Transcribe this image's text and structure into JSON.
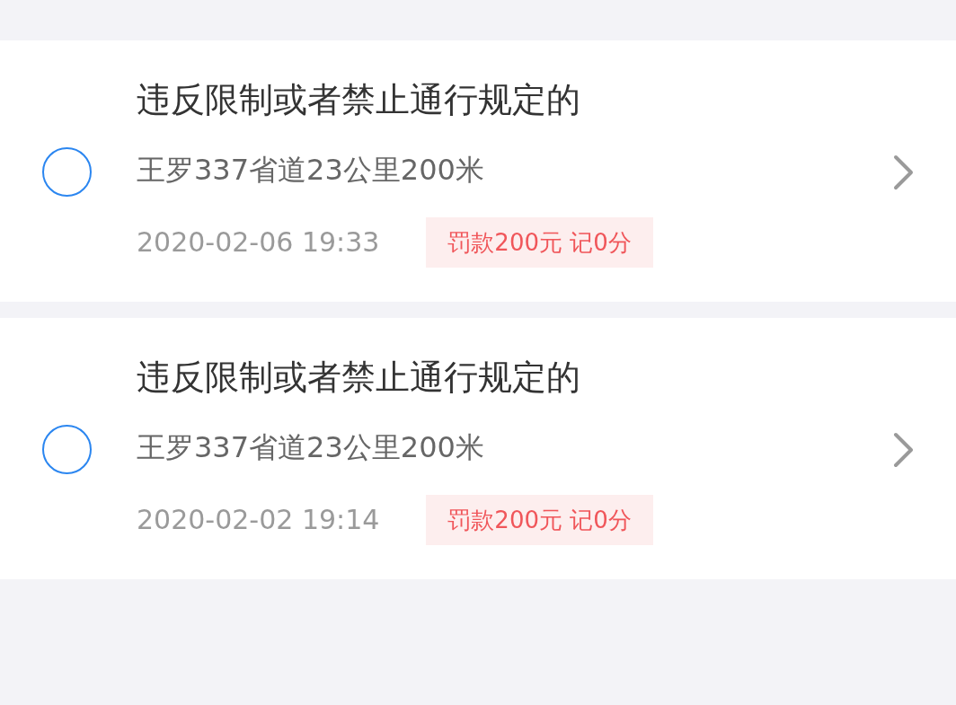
{
  "violations": [
    {
      "title": "违反限制或者禁止通行规定的",
      "location": "王罗337省道23公里200米",
      "time": "2020-02-06 19:33",
      "penalty": "罚款200元 记0分",
      "selected": false
    },
    {
      "title": "违反限制或者禁止通行规定的",
      "location": "王罗337省道23公里200米",
      "time": "2020-02-02 19:14",
      "penalty": "罚款200元 记0分",
      "selected": false
    }
  ]
}
